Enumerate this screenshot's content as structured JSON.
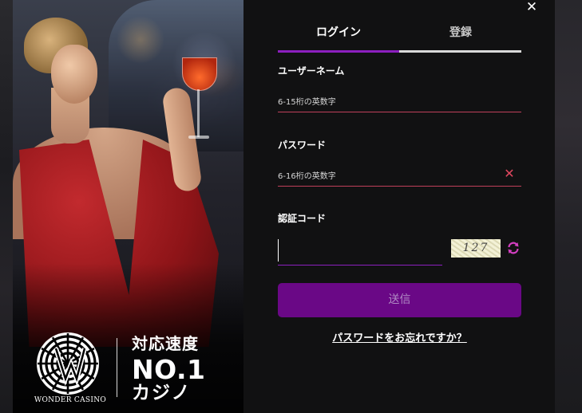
{
  "brand": {
    "logo_text": "WONDER CASINO",
    "slogan_line1": "対応速度",
    "slogan_line2": "NO.1",
    "slogan_line3": "カジノ"
  },
  "dialog": {
    "close_label": "✕"
  },
  "tabs": [
    {
      "label": "ログイン",
      "active": true
    },
    {
      "label": "登録",
      "active": false
    }
  ],
  "form": {
    "username": {
      "label": "ユーザーネーム",
      "value": "",
      "placeholder": "6-15桁の英数字"
    },
    "password": {
      "label": "パスワード",
      "value": "",
      "placeholder": "6-16桁の英数字"
    },
    "captcha": {
      "label": "認証コード",
      "value": "",
      "image_text": "127"
    },
    "submit_label": "送信",
    "forgot_label": "パスワードをお忘れですか？"
  },
  "colors": {
    "accent": "#8c1fbf",
    "button_bg": "#6a0886",
    "error_red": "#e0475f",
    "panel_bg": "#111112"
  }
}
